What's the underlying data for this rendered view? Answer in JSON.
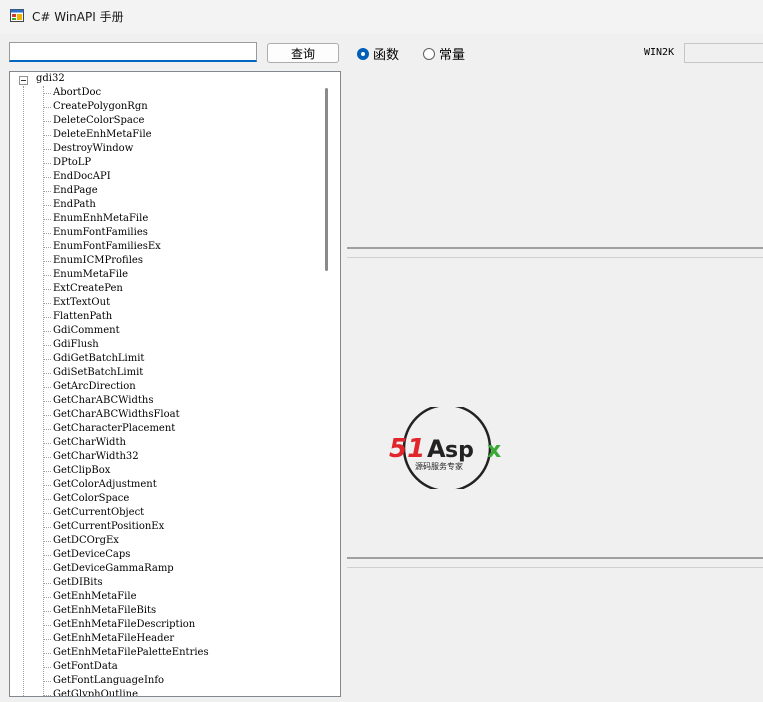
{
  "window": {
    "title": "C# WinAPI 手册"
  },
  "search": {
    "value": "",
    "button_label": "查询"
  },
  "mode": {
    "options": [
      {
        "label": "函数",
        "selected": true
      },
      {
        "label": "常量",
        "selected": false
      }
    ]
  },
  "win2k": {
    "label": "WIN2K",
    "value": ""
  },
  "tree": {
    "root": "gdi32",
    "items": [
      "AbortDoc",
      "CreatePolygonRgn",
      "DeleteColorSpace",
      "DeleteEnhMetaFile",
      "DestroyWindow",
      "DPtoLP",
      "EndDocAPI",
      "EndPage",
      "EndPath",
      "EnumEnhMetaFile",
      "EnumFontFamilies",
      "EnumFontFamiliesEx",
      "EnumICMProfiles",
      "EnumMetaFile",
      "ExtCreatePen",
      "ExtTextOut",
      "FlattenPath",
      "GdiComment",
      "GdiFlush",
      "GdiGetBatchLimit",
      "GdiSetBatchLimit",
      "GetArcDirection",
      "GetCharABCWidths",
      "GetCharABCWidthsFloat",
      "GetCharacterPlacement",
      "GetCharWidth",
      "GetCharWidth32",
      "GetClipBox",
      "GetColorAdjustment",
      "GetColorSpace",
      "GetCurrentObject",
      "GetCurrentPositionEx",
      "GetDCOrgEx",
      "GetDeviceCaps",
      "GetDeviceGammaRamp",
      "GetDIBits",
      "GetEnhMetaFile",
      "GetEnhMetaFileBits",
      "GetEnhMetaFileDescription",
      "GetEnhMetaFileHeader",
      "GetEnhMetaFilePaletteEntries",
      "GetFontData",
      "GetFontLanguageInfo",
      "GetGlyphOutline"
    ]
  },
  "watermark": {
    "brand": "51Aspx",
    "tagline": "源码服务专家"
  },
  "icons": {
    "app": "app-window-icon"
  },
  "colors": {
    "accent": "#0067c0",
    "logo_red": "#e0262b",
    "logo_green": "#3aa935",
    "logo_dark": "#222222"
  }
}
